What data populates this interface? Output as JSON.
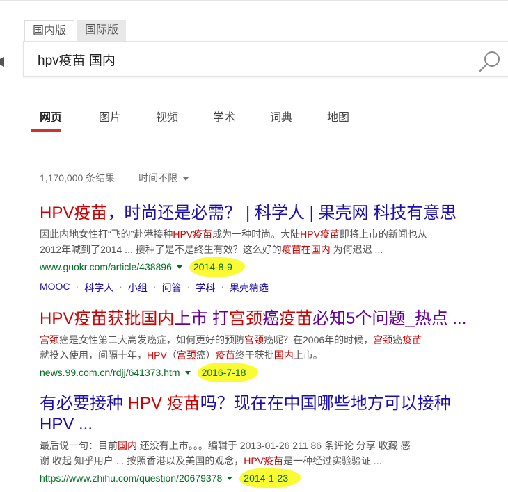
{
  "search": {
    "tabs": [
      "国内版",
      "国际版"
    ],
    "query": "hpv疫苗 国内"
  },
  "nav": [
    "网页",
    "图片",
    "视频",
    "学术",
    "词典",
    "地图"
  ],
  "stats": {
    "count": "1,170,000 条结果",
    "time_filter": "时间不限"
  },
  "results": [
    {
      "title_parts": [
        {
          "t": "HPV疫苗",
          "hl": true
        },
        {
          "t": "，时尚还是必需？ | 科学人 | 果壳网 科技有意思",
          "hl": false
        }
      ],
      "snippet_lines": [
        [
          {
            "t": "因此内地女性打“飞的”赴港接种",
            "hl": false
          },
          {
            "t": "HPV疫苗",
            "hl": true
          },
          {
            "t": "成为一种时尚。大陆",
            "hl": false
          },
          {
            "t": "HPV疫苗",
            "hl": true
          },
          {
            "t": "即将上市的新闻也从",
            "hl": false
          }
        ],
        [
          {
            "t": "2012年喊到了2014 ... 接种了是不是终生有效？这么好的",
            "hl": false
          },
          {
            "t": "疫苗在国内",
            "hl": true
          },
          {
            "t": " 为何迟迟 ...",
            "hl": false
          }
        ]
      ],
      "url": "www.guokr.com/article/438896",
      "date": "2014-8-9",
      "deeplinks": [
        "MOOC",
        "科学人",
        "小组",
        "问答",
        "学科",
        "果壳精选"
      ]
    },
    {
      "title_parts": [
        {
          "t": "HPV疫苗获批国内",
          "hl": true
        },
        {
          "t": "上市 打",
          "hl": false
        },
        {
          "t": "宫颈",
          "hl": true
        },
        {
          "t": "癌",
          "hl": false
        },
        {
          "t": "疫苗",
          "hl": true
        },
        {
          "t": "必知5个问题_热点 ...",
          "hl": false
        }
      ],
      "snippet_lines": [
        [
          {
            "t": "宫颈",
            "hl": true
          },
          {
            "t": "癌是女性第二大高发癌症，如何更好的预防",
            "hl": false
          },
          {
            "t": "宫颈",
            "hl": true
          },
          {
            "t": "癌呢？在2006年的时候，",
            "hl": false
          },
          {
            "t": "宫颈",
            "hl": true
          },
          {
            "t": "癌",
            "hl": false
          },
          {
            "t": "疫苗",
            "hl": true
          }
        ],
        [
          {
            "t": "就投入使用，间隔十年，",
            "hl": false
          },
          {
            "t": "HPV",
            "hl": true
          },
          {
            "t": "（",
            "hl": false
          },
          {
            "t": "宫颈",
            "hl": true
          },
          {
            "t": "癌）",
            "hl": false
          },
          {
            "t": "疫苗",
            "hl": true
          },
          {
            "t": "终于获批",
            "hl": false
          },
          {
            "t": "国内",
            "hl": true
          },
          {
            "t": "上市。",
            "hl": false
          }
        ]
      ],
      "url": "news.99.com.cn/rdjj/641373.htm",
      "date": "2016-7-18"
    },
    {
      "title_parts": [
        {
          "t": "有必要接种 ",
          "hl": false
        },
        {
          "t": "HPV 疫苗",
          "hl": true
        },
        {
          "t": "吗？现在在中国哪些地方可以接种 HPV ...",
          "hl": false
        }
      ],
      "snippet_lines": [
        [
          {
            "t": "最后说一句：目前",
            "hl": false
          },
          {
            "t": "国内",
            "hl": true
          },
          {
            "t": " 还没有上市。。。编辑于 2013-01-26 211 86 条评论 分享 收藏 感",
            "hl": false
          }
        ],
        [
          {
            "t": "谢 收起 知乎用户 ... 按照香港以及美国的观念，",
            "hl": false
          },
          {
            "t": "HPV疫苗",
            "hl": true
          },
          {
            "t": "是一种经过实验验证 ...",
            "hl": false
          }
        ]
      ],
      "url": "https://www.zhihu.com/question/20679378",
      "date": "2014-1-23"
    }
  ],
  "icons": {
    "search": "search-icon"
  }
}
